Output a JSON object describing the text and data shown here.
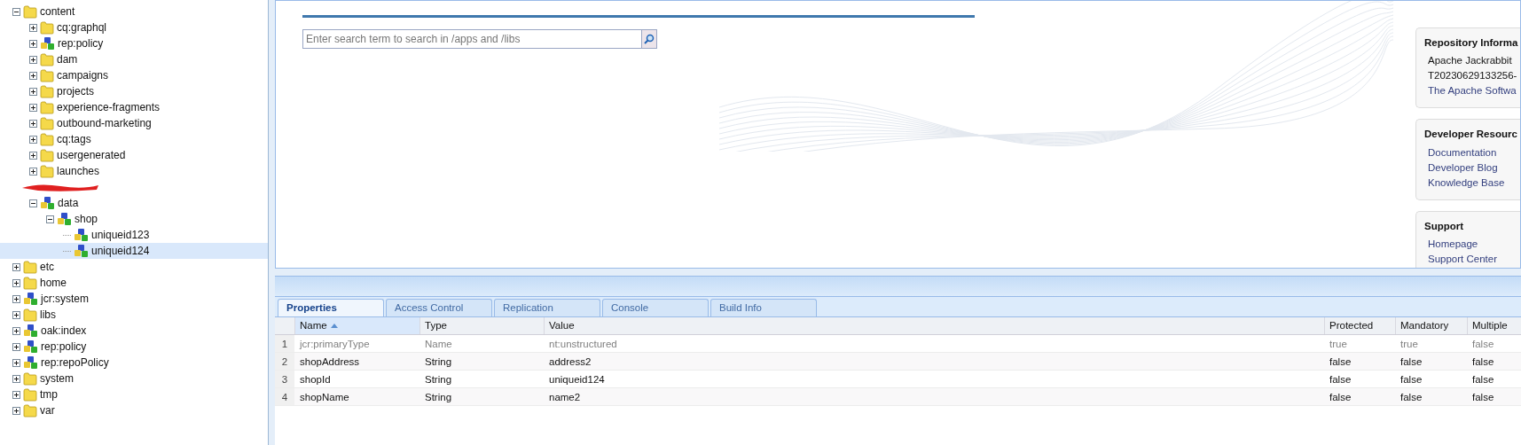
{
  "tree": [
    {
      "label": "content",
      "kind": "folder",
      "expanded": true,
      "selected": false,
      "children": [
        {
          "label": "cq:graphql",
          "kind": "folder",
          "expanded": false,
          "selected": false
        },
        {
          "label": "rep:policy",
          "kind": "node",
          "expanded": false,
          "selected": false
        },
        {
          "label": "dam",
          "kind": "folder",
          "expanded": false,
          "selected": false
        },
        {
          "label": "campaigns",
          "kind": "folder",
          "expanded": false,
          "selected": false
        },
        {
          "label": "projects",
          "kind": "folder",
          "expanded": false,
          "selected": false
        },
        {
          "label": "experience-fragments",
          "kind": "folder",
          "expanded": false,
          "selected": false
        },
        {
          "label": "outbound-marketing",
          "kind": "folder",
          "expanded": false,
          "selected": false
        },
        {
          "label": "cq:tags",
          "kind": "folder",
          "expanded": false,
          "selected": false
        },
        {
          "label": "usergenerated",
          "kind": "folder",
          "expanded": false,
          "selected": false
        },
        {
          "label": "launches",
          "kind": "folder",
          "expanded": false,
          "selected": false
        },
        {
          "kind": "redacted"
        },
        {
          "label": "data",
          "kind": "node",
          "expanded": true,
          "selected": false,
          "children": [
            {
              "label": "shop",
              "kind": "node",
              "expanded": true,
              "selected": false,
              "children": [
                {
                  "label": "uniqueid123",
                  "kind": "node",
                  "selected": false
                },
                {
                  "label": "uniqueid124",
                  "kind": "node",
                  "selected": true
                }
              ]
            }
          ]
        }
      ]
    },
    {
      "label": "etc",
      "kind": "folder",
      "expanded": false,
      "selected": false
    },
    {
      "label": "home",
      "kind": "folder",
      "expanded": false,
      "selected": false
    },
    {
      "label": "jcr:system",
      "kind": "node",
      "expanded": false,
      "selected": false
    },
    {
      "label": "libs",
      "kind": "folder",
      "expanded": false,
      "selected": false
    },
    {
      "label": "oak:index",
      "kind": "node",
      "expanded": false,
      "selected": false
    },
    {
      "label": "rep:policy",
      "kind": "node",
      "expanded": false,
      "selected": false
    },
    {
      "label": "rep:repoPolicy",
      "kind": "node",
      "expanded": false,
      "selected": false
    },
    {
      "label": "system",
      "kind": "folder",
      "expanded": false,
      "selected": false
    },
    {
      "label": "tmp",
      "kind": "folder",
      "expanded": false,
      "selected": false
    },
    {
      "label": "var",
      "kind": "folder",
      "expanded": false,
      "selected": false
    }
  ],
  "search": {
    "placeholder": "Enter search term to search in /apps and /libs"
  },
  "panels": [
    {
      "title": "Repository Informa",
      "lines": [
        {
          "kind": "text",
          "text": "Apache Jackrabbit"
        },
        {
          "kind": "text",
          "text": "T20230629133256-"
        },
        {
          "kind": "link",
          "text": "The Apache Softwa"
        }
      ]
    },
    {
      "title": "Developer Resourc",
      "lines": [
        {
          "kind": "link",
          "text": "Documentation"
        },
        {
          "kind": "link",
          "text": "Developer Blog"
        },
        {
          "kind": "link",
          "text": "Knowledge Base"
        }
      ]
    },
    {
      "title": "Support",
      "lines": [
        {
          "kind": "link",
          "text": "Homepage"
        },
        {
          "kind": "link",
          "text": "Support Center"
        }
      ]
    }
  ],
  "tabs": [
    {
      "label": "Properties",
      "selected": true
    },
    {
      "label": "Access Control",
      "selected": false
    },
    {
      "label": "Replication",
      "selected": false
    },
    {
      "label": "Console",
      "selected": false
    },
    {
      "label": "Build Info",
      "selected": false
    }
  ],
  "table": {
    "columns": [
      {
        "label": "Name",
        "sorted": true
      },
      {
        "label": "Type",
        "sorted": false
      },
      {
        "label": "Value",
        "sorted": false
      },
      {
        "label": "Protected",
        "sorted": false
      },
      {
        "label": "Mandatory",
        "sorted": false
      },
      {
        "label": "Multiple",
        "sorted": false
      }
    ],
    "rows": [
      {
        "number": "1",
        "greyed": true,
        "cells": [
          "jcr:primaryType",
          "Name",
          "nt:unstructured",
          "true",
          "true",
          "false"
        ]
      },
      {
        "number": "2",
        "greyed": false,
        "cells": [
          "shopAddress",
          "String",
          "address2",
          "false",
          "false",
          "false"
        ]
      },
      {
        "number": "3",
        "greyed": false,
        "cells": [
          "shopId",
          "String",
          "uniqueid124",
          "false",
          "false",
          "false"
        ]
      },
      {
        "number": "4",
        "greyed": false,
        "cells": [
          "shopName",
          "String",
          "name2",
          "false",
          "false",
          "false"
        ]
      }
    ]
  }
}
